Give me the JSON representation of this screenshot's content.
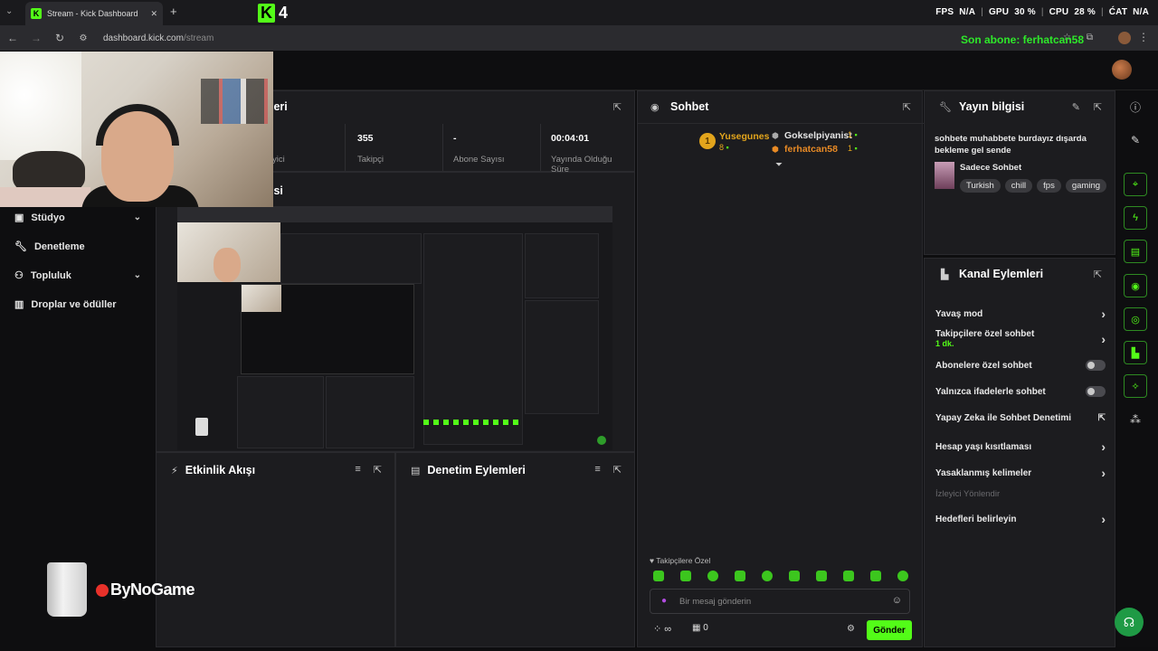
{
  "browser": {
    "tab_title": "Stream - Kick Dashboard",
    "new_tab": "+",
    "url_host": "dashboard.kick.com",
    "url_path": "/stream"
  },
  "overlay": {
    "fps_label": "FPS",
    "fps_value": "N/A",
    "gpu_label": "GPU",
    "gpu_value": "30 %",
    "cpu_label": "CPU",
    "cpu_value": "28 %",
    "last_label": "ĆAT",
    "last_value": "N/A",
    "last_sub": "Son abone: ferhatcan58",
    "k4": "4"
  },
  "sidebar": {
    "items": [
      {
        "label": "Stüdyo",
        "icon": "studio-icon",
        "chevron": "⌄"
      },
      {
        "label": "Denetleme",
        "icon": "wrench-icon"
      },
      {
        "label": "Topluluk",
        "icon": "community-icon",
        "chevron": "⌄"
      },
      {
        "label": "Droplar ve ödüller",
        "icon": "chart-icon"
      }
    ]
  },
  "stream_panel": {
    "title_partial": "leri",
    "preview_title_partial": "isi",
    "stats": [
      {
        "value": "",
        "label": "yici"
      },
      {
        "value": "355",
        "label": "Takipçi"
      },
      {
        "value": "-",
        "label": "Abone Sayısı"
      },
      {
        "value": "00:04:01",
        "label": "Yayında Olduğu Süre"
      }
    ]
  },
  "activity": {
    "title": "Etkinlik Akışı"
  },
  "moderation": {
    "title": "Denetim Eylemleri"
  },
  "chat": {
    "title": "Sohbet",
    "leaders": [
      {
        "rank": "1",
        "name": "Yusegunes",
        "count": "8"
      },
      {
        "name": "Gokselpiyanist",
        "count": "1"
      },
      {
        "name": "ferhatcan58",
        "count": "1"
      }
    ],
    "followers_only": "Takipçilere Özel",
    "input_placeholder": "Bir mesaj gönderin",
    "points": "∞",
    "gifts": "0",
    "send": "Gönder"
  },
  "stream_info": {
    "title": "Yayın bilgisi",
    "description": "sohbete muhabbete burdayız dışarda bekleme gel sende",
    "category": "Sadece Sohbet",
    "tags": [
      "Turkish",
      "chill",
      "fps",
      "gaming"
    ]
  },
  "channel_actions": {
    "title": "Kanal Eylemleri",
    "items": [
      {
        "label": "Yavaş mod",
        "control": "chevron"
      },
      {
        "label": "Takipçilere özel sohbet",
        "sub": "1 dk.",
        "control": "chevron"
      },
      {
        "label": "Abonelere özel sohbet",
        "control": "toggle",
        "on": false
      },
      {
        "label": "Yalnızca ifadelerle sohbet",
        "control": "toggle",
        "on": false
      },
      {
        "label": "Yapay Zeka ile Sohbet Denetimi",
        "control": "external"
      },
      {
        "label": "Hesap yaşı kısıtlaması",
        "control": "chevron"
      },
      {
        "label": "Yasaklanmış kelimeler",
        "control": "chevron"
      },
      {
        "label": "İzleyici Yönlendir",
        "control": "none",
        "disabled": true
      },
      {
        "label": "Hedefleri belirleyin",
        "control": "chevron"
      }
    ]
  },
  "colors": {
    "accent": "#53fc18",
    "leader_gold": "#e3a51c",
    "user_orange": "#e88a25"
  },
  "brand": {
    "text": "ByNoGame"
  }
}
